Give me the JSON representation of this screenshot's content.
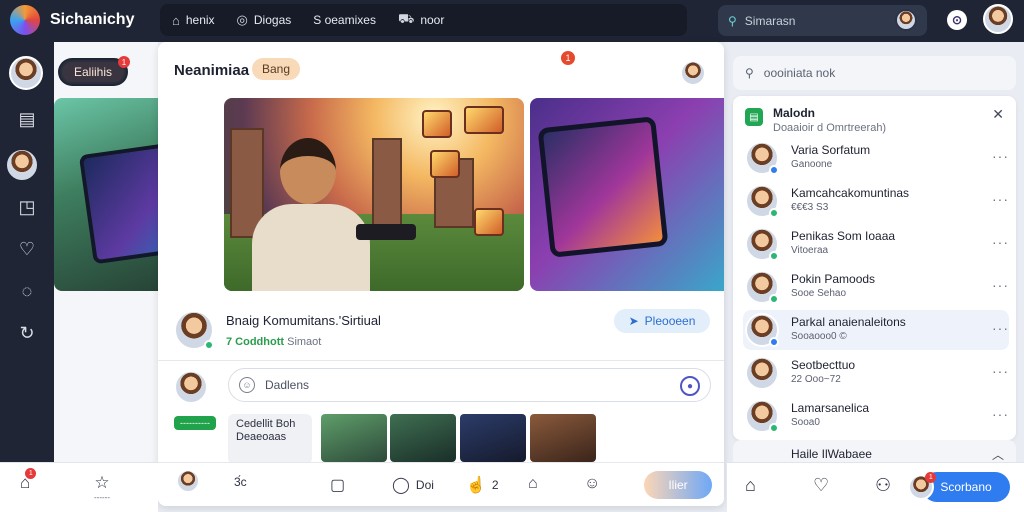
{
  "app": {
    "name": "Sichanichy"
  },
  "topnav": {
    "items": [
      {
        "label": "henix",
        "icon": "home-icon"
      },
      {
        "label": "Diogas",
        "icon": "compass-icon"
      },
      {
        "label": "S oeamixes",
        "icon": "dollar-icon"
      },
      {
        "label": "noor",
        "icon": "car-icon"
      }
    ],
    "search_placeholder": "Simarasn"
  },
  "left": {
    "pill_label": "Ealiihis",
    "pill_badge": "1"
  },
  "main": {
    "title": "Neanimiaa",
    "chip": "Bang",
    "notif_count": "1",
    "post": {
      "title": "Bnaig Komumitans.'Sirtiual",
      "meta_green": "7 Coddhott",
      "meta_grey": "Simaot",
      "button": "Pleooeen"
    },
    "composer_placeholder": "Dadlens",
    "gallery": {
      "tag": "----------",
      "card_title": "Cedellit Boh",
      "card_sub": "Deaeoaas"
    },
    "bottom": {
      "item1_count": "3́c",
      "item2_label": "Doi",
      "item3_count": "2",
      "pill_label": "Ilier",
      "badge": "1"
    }
  },
  "bottombar": {
    "badge": "1",
    "star_label": "------"
  },
  "right": {
    "search_placeholder": "oooiniata nok",
    "panel": {
      "title": "Malodn",
      "subtitle": "Doaaioir d Omrtreerah)",
      "friends": [
        {
          "name": "Varia Sorfatum",
          "sub": "Ganoone"
        },
        {
          "name": "Kamcahcakomuntinas",
          "sub": "€€€3 S3"
        },
        {
          "name": "Penikas Som Ioaaa",
          "sub": "Vitoeraa"
        },
        {
          "name": "Pokin Pamoods",
          "sub": "Sooe Sehao"
        },
        {
          "name": "Parkal anaienaleitons",
          "sub": "Sooaooo0 ©"
        },
        {
          "name": "Seotbecttuo",
          "sub": "22 Ooo~72"
        },
        {
          "name": "Lamarsanelica",
          "sub": "Sooa0"
        }
      ],
      "footer_name": "Haile IlWabaee"
    },
    "bottom_pill": "Scorbano",
    "bottom_badge": "1"
  }
}
